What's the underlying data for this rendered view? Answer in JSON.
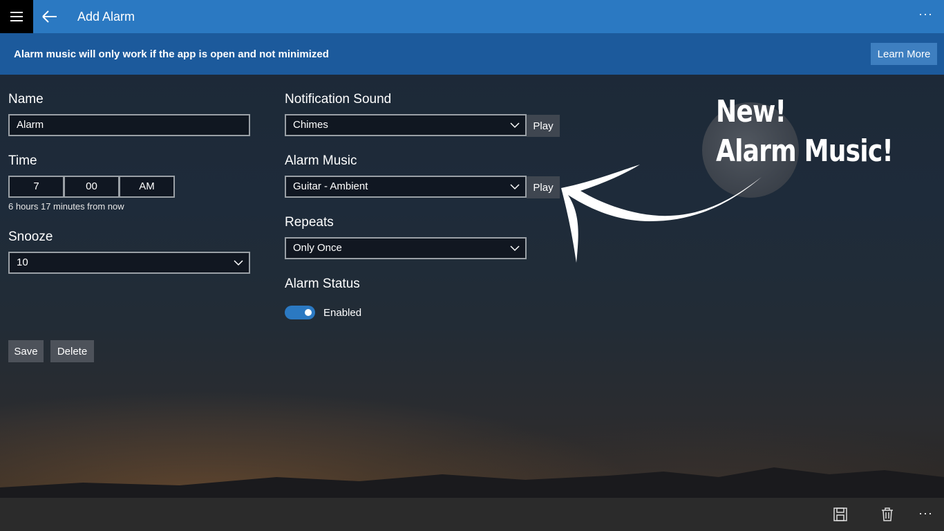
{
  "titlebar": {
    "title": "Add Alarm",
    "more": "···"
  },
  "banner": {
    "message": "Alarm music will only work if the app is open and not minimized",
    "learn_more": "Learn More"
  },
  "form": {
    "name": {
      "label": "Name",
      "value": "Alarm"
    },
    "time": {
      "label": "Time",
      "hour": "7",
      "minute": "00",
      "period": "AM",
      "hint": "6 hours 17 minutes from now"
    },
    "snooze": {
      "label": "Snooze",
      "value": "10"
    },
    "notification_sound": {
      "label": "Notification Sound",
      "value": "Chimes",
      "play": "Play"
    },
    "alarm_music": {
      "label": "Alarm Music",
      "value": "Guitar - Ambient",
      "play": "Play"
    },
    "repeats": {
      "label": "Repeats",
      "value": "Only Once"
    },
    "alarm_status": {
      "label": "Alarm Status",
      "toggle_label": "Enabled",
      "enabled": true
    },
    "save": "Save",
    "delete": "Delete"
  },
  "promo": {
    "line1": "New!",
    "line2": "Alarm Music!"
  },
  "commandbar": {
    "icons": [
      "save-icon",
      "delete-icon"
    ],
    "more": "···"
  },
  "colors": {
    "accent": "#2b79c2",
    "banner": "#1c5a9c",
    "commandbar": "#2b2b2b"
  }
}
